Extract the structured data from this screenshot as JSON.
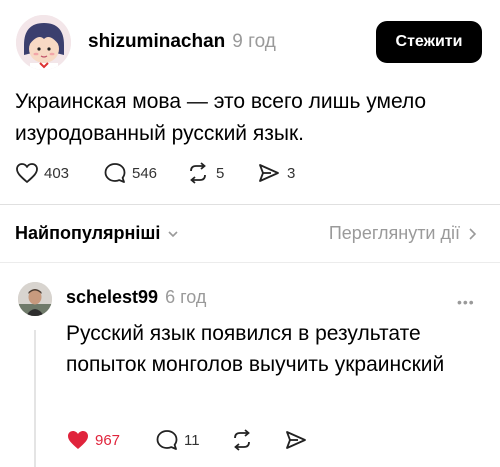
{
  "post": {
    "author": "shizuminachan",
    "time": "9 год",
    "follow_label": "Стежити",
    "text": "Украинская мова — это всего лишь умело изуродованный русский язык.",
    "stats": {
      "likes": "403",
      "comments": "546",
      "reposts": "5",
      "shares": "3"
    }
  },
  "replies_header": {
    "sort_label": "Найпопулярніші",
    "activity_label": "Переглянути дії"
  },
  "comment": {
    "author": "schelest99",
    "time": "6 год",
    "more": "•••",
    "text": "Русский язык появился в результате попыток монголов выучить украинский",
    "stats": {
      "likes": "967",
      "comments": "11"
    }
  },
  "colors": {
    "like_red": "#e0243c",
    "muted": "#9a9a9a",
    "text": "#000000"
  }
}
